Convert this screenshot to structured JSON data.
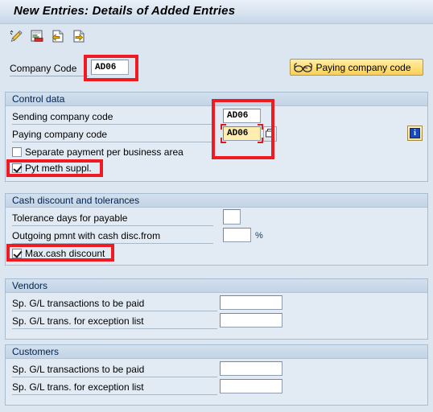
{
  "window": {
    "title": "New Entries: Details of Added Entries"
  },
  "toolbar": {
    "buttons": [
      {
        "name": "edit-pencil-icon",
        "tooltip": "Change display/change"
      },
      {
        "name": "document-table-icon",
        "tooltip": "Display document"
      },
      {
        "name": "page-previous-icon",
        "tooltip": "Previous entry"
      },
      {
        "name": "page-next-icon",
        "tooltip": "Next entry"
      }
    ]
  },
  "header": {
    "company_code_label": "Company Code",
    "company_code_value": "AD06",
    "paying_company_code_button": "Paying company code"
  },
  "sections": {
    "control_data": {
      "title": "Control data",
      "sending_company_code_label": "Sending company code",
      "sending_company_code_value": "AD06",
      "paying_company_code_label": "Paying company code",
      "paying_company_code_value": "AD06",
      "separate_payment_label": "Separate payment per business area",
      "separate_payment_checked": false,
      "pyt_meth_suppl_label": "Pyt meth suppl.",
      "pyt_meth_suppl_checked": true
    },
    "cash_discount": {
      "title": "Cash discount and tolerances",
      "tolerance_days_label": "Tolerance days for payable",
      "tolerance_days_value": "",
      "outgoing_pmnt_label": "Outgoing pmnt with cash disc.from",
      "outgoing_pmnt_value": "",
      "percent_symbol": "%",
      "max_cash_discount_label": "Max.cash discount",
      "max_cash_discount_checked": true
    },
    "vendors": {
      "title": "Vendors",
      "sp_gl_to_be_paid_label": "Sp. G/L transactions to be paid",
      "sp_gl_to_be_paid_value": "",
      "sp_gl_exception_label": "Sp. G/L trans. for exception list",
      "sp_gl_exception_value": ""
    },
    "customers": {
      "title": "Customers",
      "sp_gl_to_be_paid_label": "Sp. G/L transactions to be paid",
      "sp_gl_to_be_paid_value": "",
      "sp_gl_exception_label": "Sp. G/L trans. for exception list",
      "sp_gl_exception_value": ""
    }
  },
  "colors": {
    "annotation_red": "#ee1b22",
    "focus_field_yellow": "#ffeeb0",
    "button_yellow": "#ffe07a",
    "panel_background": "#e2ebf4",
    "app_background": "#dce6f0"
  }
}
